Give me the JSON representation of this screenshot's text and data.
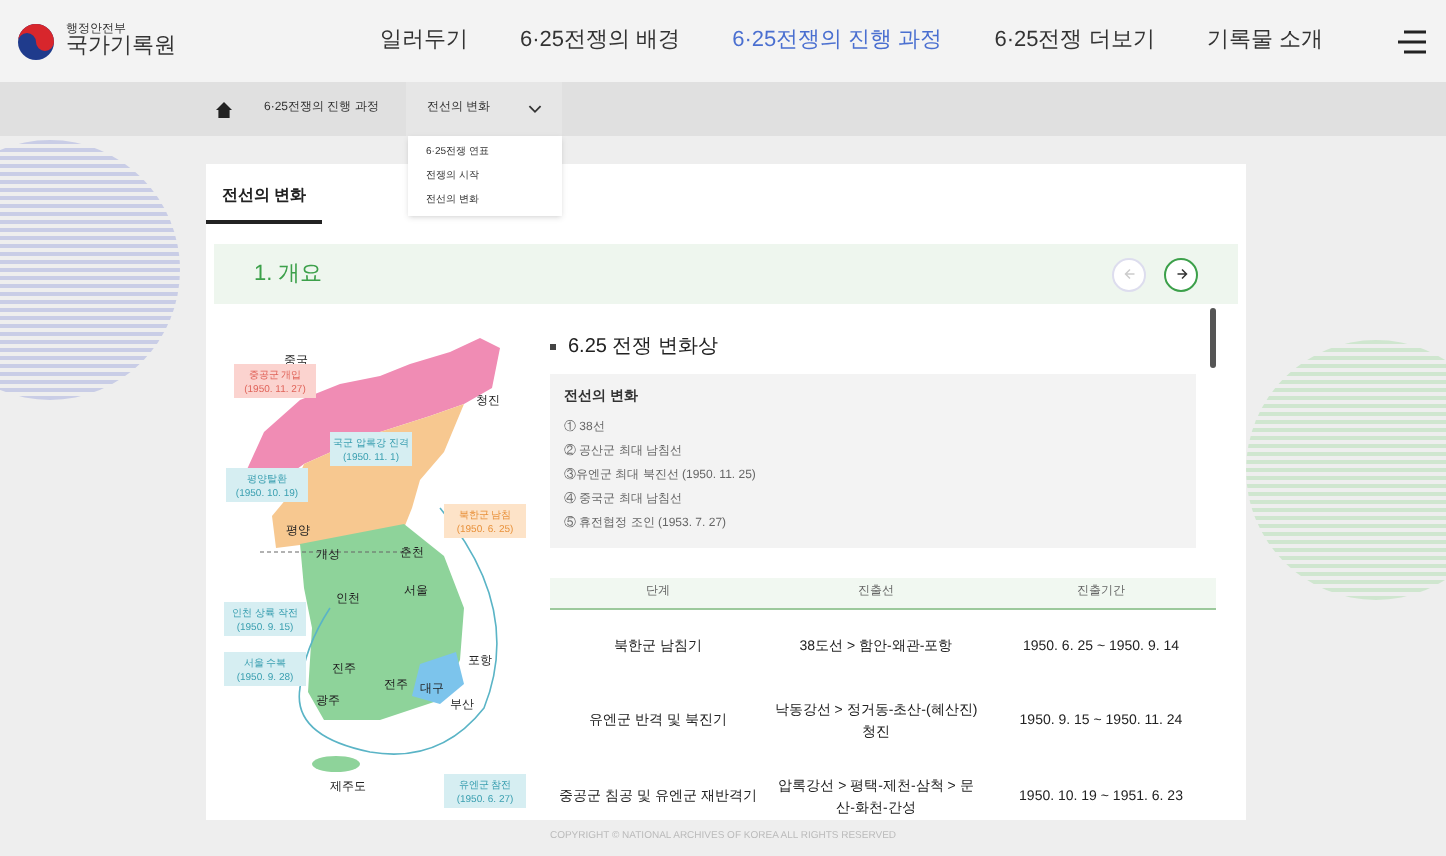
{
  "logo": {
    "ministry": "행정안전부",
    "name": "국가기록원"
  },
  "nav": [
    {
      "label": "일러두기",
      "selected": false
    },
    {
      "label": "6·25전쟁의 배경",
      "selected": false
    },
    {
      "label": "6·25전쟁의 진행 과정",
      "selected": true
    },
    {
      "label": "6·25전쟁 더보기",
      "selected": false
    },
    {
      "label": "기록물 소개",
      "selected": false
    }
  ],
  "breadcrumb": {
    "section": "6·25전쟁의 진행 과정",
    "current": "전선의 변화",
    "expanded": true,
    "options": [
      "6·25전쟁 연표",
      "전쟁의 시작",
      "전선의 변화"
    ]
  },
  "tabs": [
    {
      "label": "전선의 변화",
      "selected": true
    }
  ],
  "section_title": "1. 개요",
  "map_labels": [
    {
      "kind": "place",
      "text": "중국"
    },
    {
      "kind": "event",
      "text": "중공군 개입",
      "date": "(1950. 11. 27)",
      "color": "#fbd3cf"
    },
    {
      "kind": "place",
      "text": "청진"
    },
    {
      "kind": "event",
      "text": "국군 압록강 진격",
      "date": "(1950. 11. 1)",
      "color": "#d6eef2"
    },
    {
      "kind": "event",
      "text": "평양탈환",
      "date": "(1950. 10. 19)",
      "color": "#d6eef2"
    },
    {
      "kind": "place",
      "text": "평양"
    },
    {
      "kind": "event",
      "text": "북한군 남침",
      "date": "(1950. 6. 25)",
      "color": "#fde3c8"
    },
    {
      "kind": "place",
      "text": "개성"
    },
    {
      "kind": "place",
      "text": "춘천"
    },
    {
      "kind": "place",
      "text": "인천"
    },
    {
      "kind": "place",
      "text": "서울"
    },
    {
      "kind": "event",
      "text": "인천 상륙 작전",
      "date": "(1950. 9. 15)",
      "color": "#d6eef2"
    },
    {
      "kind": "event",
      "text": "서울 수복",
      "date": "(1950. 9. 28)",
      "color": "#d6eef2"
    },
    {
      "kind": "place",
      "text": "진주"
    },
    {
      "kind": "place",
      "text": "전주"
    },
    {
      "kind": "place",
      "text": "광주"
    },
    {
      "kind": "place",
      "text": "대구"
    },
    {
      "kind": "place",
      "text": "포항"
    },
    {
      "kind": "place",
      "text": "부산"
    },
    {
      "kind": "place",
      "text": "제주도"
    },
    {
      "kind": "event",
      "text": "유엔군 참전",
      "date": "(1950. 6. 27)",
      "color": "#d6eef2"
    }
  ],
  "panel": {
    "title": "6.25 전쟁 변화상",
    "box_title": "전선의 변화",
    "lines": [
      "① 38선",
      "② 공산군 최대 남침선",
      "③유엔군 최대 북진선 (1950. 11. 25)",
      "④ 중국군 최대 남침선",
      "⑤ 휴전협정 조인 (1953. 7. 27)"
    ]
  },
  "table": {
    "columns": [
      "단계",
      "진출선",
      "진출기간"
    ],
    "rows": [
      [
        "북한군 남침기",
        "38도선 > 함안-왜관-포항",
        "1950. 6. 25 ~ 1950. 9. 14"
      ],
      [
        "유엔군 반격 및 북진기",
        "낙동강선 > 정거동-초산-(혜산진)청진",
        "1950. 9. 15 ~ 1950. 11. 24"
      ],
      [
        "중공군 침공 및 유엔군 재반격기",
        "압록강선 > 평택-제천-삼척 > 문산-화천-간성",
        "1950. 10. 19 ~ 1951. 6. 23"
      ]
    ]
  },
  "footer": "COPYRIGHT © NATIONAL ARCHIVES OF KOREA ALL RIGHTS RESERVED"
}
